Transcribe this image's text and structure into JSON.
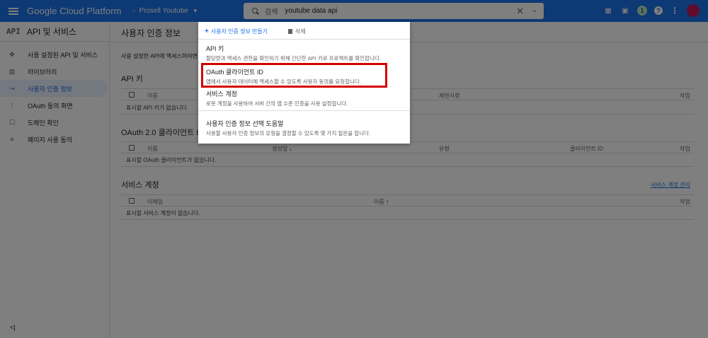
{
  "topbar": {
    "brand": "Google Cloud Platform",
    "project": "Prosell Youtube",
    "search_label": "검색",
    "search_query": "youtube data api",
    "icons": [
      "gift-icon",
      "terminal-icon",
      "notification-badge",
      "help-icon",
      "more-vert-icon",
      "avatar"
    ],
    "badge_count": "1",
    "bg_color": "#1a73e8"
  },
  "sidebar": {
    "api_label": "API",
    "title": "API 및 서비스",
    "items": [
      {
        "label": "사용 설정된 API 및 서비스",
        "icon": "enabled-apis-icon"
      },
      {
        "label": "라이브러리",
        "icon": "library-icon"
      },
      {
        "label": "사용자 인증 정보",
        "icon": "key-icon",
        "active": true
      },
      {
        "label": "OAuth 동의 화면",
        "icon": "consent-icon"
      },
      {
        "label": "도메인 확인",
        "icon": "domain-icon"
      },
      {
        "label": "페이지 사용 동의",
        "icon": "page-agreement-icon"
      }
    ],
    "collapse": "<|"
  },
  "main": {
    "title": "사용자 인증 정보",
    "intro": "사용 설정한 API에 액세스하려면",
    "api_keys": {
      "title": "API 키",
      "columns": {
        "name": "이름",
        "restrictions": "제한사항",
        "actions": "작업"
      },
      "empty": "표시할 API 키가 없습니다."
    },
    "oauth": {
      "title": "OAuth 2.0 클라이언트 ID",
      "columns": {
        "name": "이름",
        "created": "생성일",
        "type": "유형",
        "client_id": "클라이언트 ID",
        "actions": "작업"
      },
      "empty": "표시할 OAuth 클라이언트가 없습니다."
    },
    "service_accounts": {
      "title": "서비스 계정",
      "manage_link": "서비스 계정 관리",
      "columns": {
        "email": "이메일",
        "name": "이름",
        "actions": "작업"
      },
      "empty": "표시할 서비스 계정이 없습니다."
    }
  },
  "menu": {
    "create_label": "사용자 인증 정보 만들기",
    "delete_label": "삭제",
    "options": [
      {
        "title": "API 키",
        "desc": "할당량과 액세스 권한을 확인하기 위해 간단한 API 키로 프로젝트를 확인합니다."
      },
      {
        "title": "OAuth 클라이언트 ID",
        "desc": "앱에서 사용자 데이터에 액세스할 수 있도록 사용자 동의를 요청합니다."
      },
      {
        "title": "서비스 계정",
        "desc": "로봇 계정을 사용하여 서버 간의 앱 수준 인증을 사용 설정합니다."
      },
      {
        "title": "사용자 인증 정보 선택 도움말",
        "desc": "사용할 사용자 인증 정보의 유형을 결정할 수 있도록 몇 가지 질문을 합니다."
      }
    ],
    "highlight_color": "#d50000"
  }
}
